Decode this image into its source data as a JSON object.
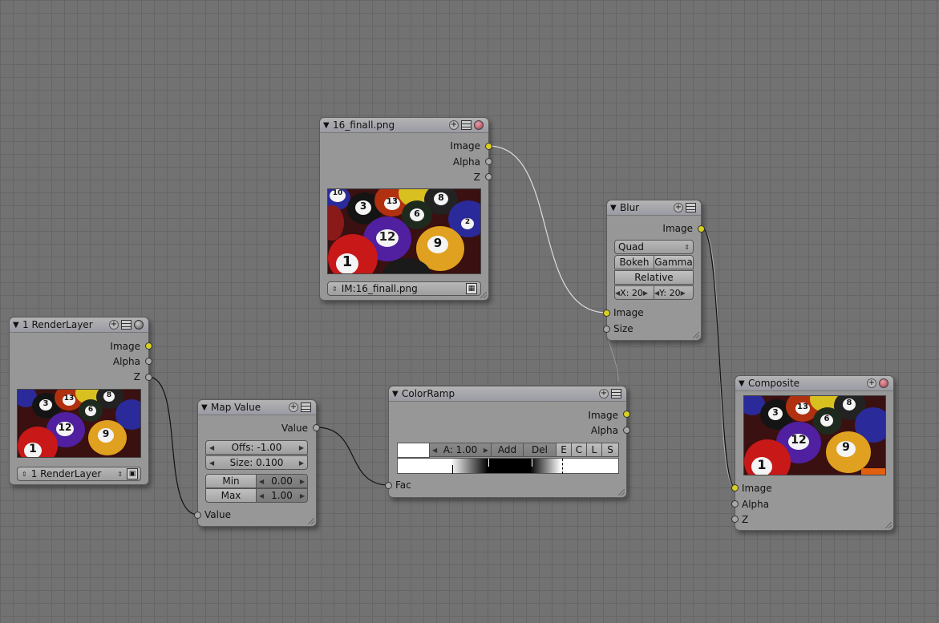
{
  "nodes": {
    "image": {
      "title": "16_finall.png",
      "outputs": [
        "Image",
        "Alpha",
        "Z"
      ],
      "image_field": "IM:16_finall.png"
    },
    "blur": {
      "title": "Blur",
      "output": "Image",
      "filter": "Quad",
      "bokeh": "Bokeh",
      "gamma": "Gamma",
      "relative": "Relative",
      "x_label": "X: 20",
      "y_label": "Y: 20",
      "inputs": [
        "Image",
        "Size"
      ]
    },
    "renderlayer": {
      "title": "1 RenderLayer",
      "outputs": [
        "Image",
        "Alpha",
        "Z"
      ],
      "layer_field": "1 RenderLayer"
    },
    "mapvalue": {
      "title": "Map Value",
      "output": "Value",
      "offs": "Offs: -1.00",
      "size": "Size: 0.100",
      "min_label": "Min",
      "min_value": "0.00",
      "max_label": "Max",
      "max_value": "1.00",
      "input": "Value"
    },
    "colorramp": {
      "title": "ColorRamp",
      "outputs": [
        "Image",
        "Alpha"
      ],
      "alpha_field": "A: 1.00",
      "add": "Add",
      "del": "Del",
      "e": "E",
      "c": "C",
      "l": "L",
      "s": "S",
      "input": "Fac"
    },
    "composite": {
      "title": "Composite",
      "inputs": [
        "Image",
        "Alpha",
        "Z"
      ]
    }
  },
  "colors": {
    "background": "#727272",
    "node_body": "#979797",
    "socket_image": "#d8d020",
    "socket_value": "#a8a8a8"
  },
  "icons": [
    "plus-icon",
    "list-icon",
    "record-icon",
    "sphere-icon",
    "collapse-triangle-icon"
  ]
}
